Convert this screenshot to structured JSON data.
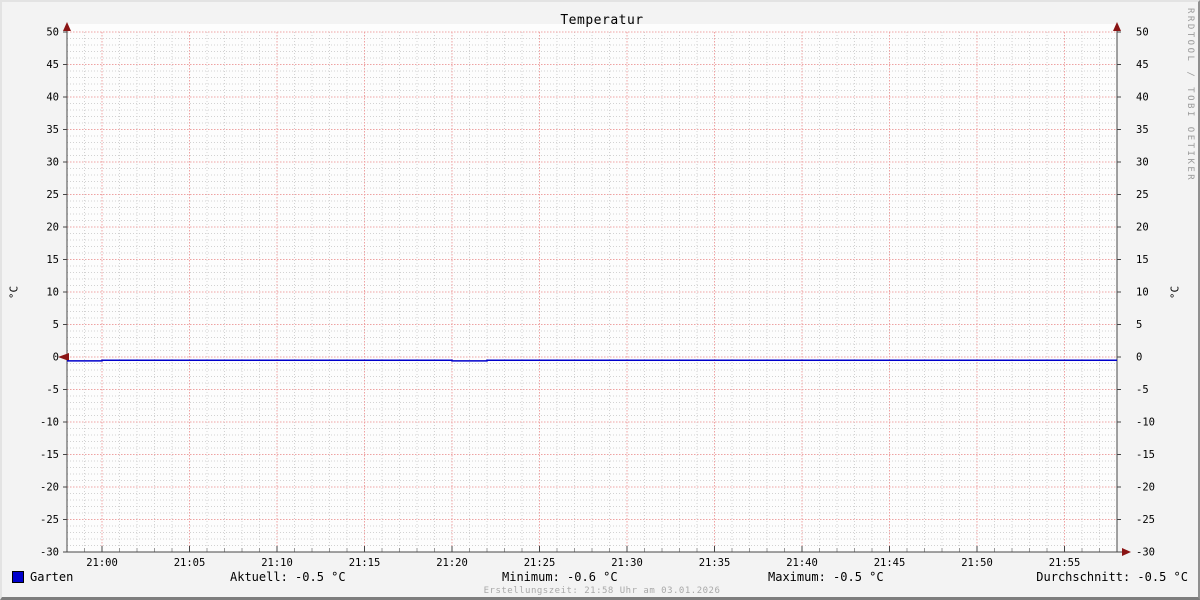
{
  "title": "Temperatur",
  "watermark": "RRDTOOL / TOBI OETIKER",
  "axis_unit_left": "°C",
  "axis_unit_right": "°C",
  "legend": {
    "series_label": "Garten",
    "series_color": "#0000cc"
  },
  "stats": {
    "aktuell": "Aktuell: -0.5 °C",
    "minimum": "Minimum: -0.6 °C",
    "maximum": "Maximum: -0.5 °C",
    "durchschnitt": "Durchschnitt: -0.5 °C"
  },
  "footer": "Erstellungszeit: 21:58 Uhr am 03.01.2026",
  "chart_data": {
    "type": "line",
    "title": "Temperatur",
    "ylabel": "°C",
    "ylim": [
      -30,
      50
    ],
    "y_major_step": 5,
    "y_minor_step": 1,
    "y_tick_labels": [
      50,
      45,
      40,
      35,
      30,
      25,
      20,
      15,
      10,
      5,
      0,
      -5,
      -10,
      -15,
      -20,
      -25,
      -30
    ],
    "x_start": "20:58",
    "x_end": "21:58",
    "x_major_ticks": [
      "21:00",
      "21:05",
      "21:10",
      "21:15",
      "21:20",
      "21:25",
      "21:30",
      "21:35",
      "21:40",
      "21:45",
      "21:50",
      "21:55"
    ],
    "x_minor_step_minutes": 1,
    "grid": {
      "canvas": "#fdfdfd",
      "major_color": "#eea2a2",
      "minor_color": "#d2d2d2",
      "axis_color": "#474747",
      "arrow_color": "#8a1414"
    },
    "legend_position": "bottom",
    "series": [
      {
        "name": "Garten",
        "color": "#0000cc",
        "step": true,
        "points": [
          {
            "t": "20:58",
            "v": -0.6
          },
          {
            "t": "21:00",
            "v": -0.5
          },
          {
            "t": "21:20",
            "v": -0.6
          },
          {
            "t": "21:22",
            "v": -0.5
          },
          {
            "t": "21:58",
            "v": -0.5
          }
        ]
      }
    ],
    "stats": {
      "aktuell": -0.5,
      "minimum": -0.6,
      "maximum": -0.5,
      "durchschnitt": -0.5
    }
  }
}
